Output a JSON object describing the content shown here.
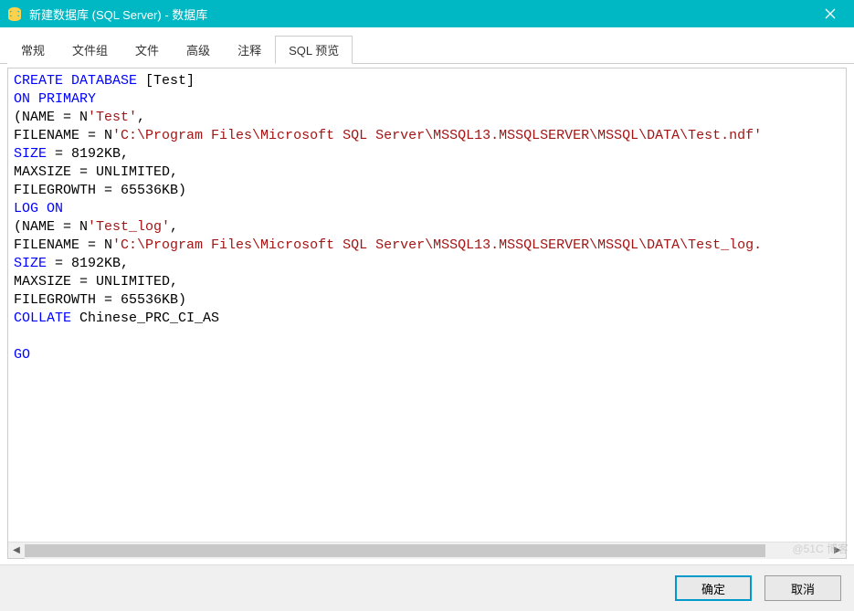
{
  "window": {
    "title": "新建数据库 (SQL Server) - 数据库"
  },
  "tabs": {
    "items": [
      {
        "label": "常规"
      },
      {
        "label": "文件组"
      },
      {
        "label": "文件"
      },
      {
        "label": "高级"
      },
      {
        "label": "注释"
      },
      {
        "label": "SQL 预览"
      }
    ],
    "activeIndex": 5
  },
  "sql": {
    "kw_create": "CREATE",
    "kw_database": "DATABASE",
    "db_name": " [Test]",
    "kw_on": "ON",
    "kw_primary": "PRIMARY",
    "line_name1_a": "(NAME = N",
    "str_test": "'Test'",
    "comma": ",",
    "line_name2_a": "(NAME = N",
    "str_test_log": "'Test_log'",
    "filename_prefix": "FILENAME = N",
    "str_path1": "'C:\\Program Files\\Microsoft SQL Server\\MSSQL13.MSSQLSERVER\\MSSQL\\DATA\\Test.ndf'",
    "str_path2": "'C:\\Program Files\\Microsoft SQL Server\\MSSQL13.MSSQLSERVER\\MSSQL\\DATA\\Test_log.",
    "kw_size": "SIZE",
    "size_val": " = 8192KB,",
    "maxsize": "MAXSIZE = UNLIMITED,",
    "filegrowth": "FILEGROWTH = 65536KB)",
    "kw_log": "LOG",
    "kw_on2": "ON",
    "kw_collate": "COLLATE",
    "collate_val": " Chinese_PRC_CI_AS",
    "kw_go": "GO"
  },
  "footer": {
    "ok": "确定",
    "cancel": "取消"
  },
  "watermark": "@51C   博客"
}
